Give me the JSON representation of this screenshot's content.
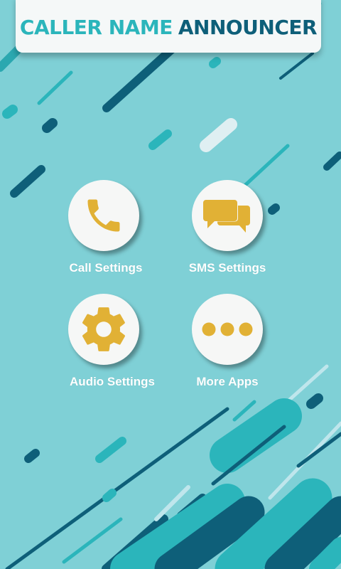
{
  "header": {
    "title_part1": "CALLER NAME",
    "title_part2": "ANNOUNCER"
  },
  "menu": [
    {
      "label": "Call Settings",
      "icon": "phone-icon"
    },
    {
      "label": "SMS Settings",
      "icon": "chat-bubbles-icon"
    },
    {
      "label": "Audio Settings",
      "icon": "gear-icon"
    },
    {
      "label": "More Apps",
      "icon": "more-dots-icon"
    }
  ],
  "colors": {
    "background": "#7fd0d6",
    "icon": "#e1b135",
    "title_light": "#2bb5bb",
    "title_dark": "#0e5f79"
  }
}
